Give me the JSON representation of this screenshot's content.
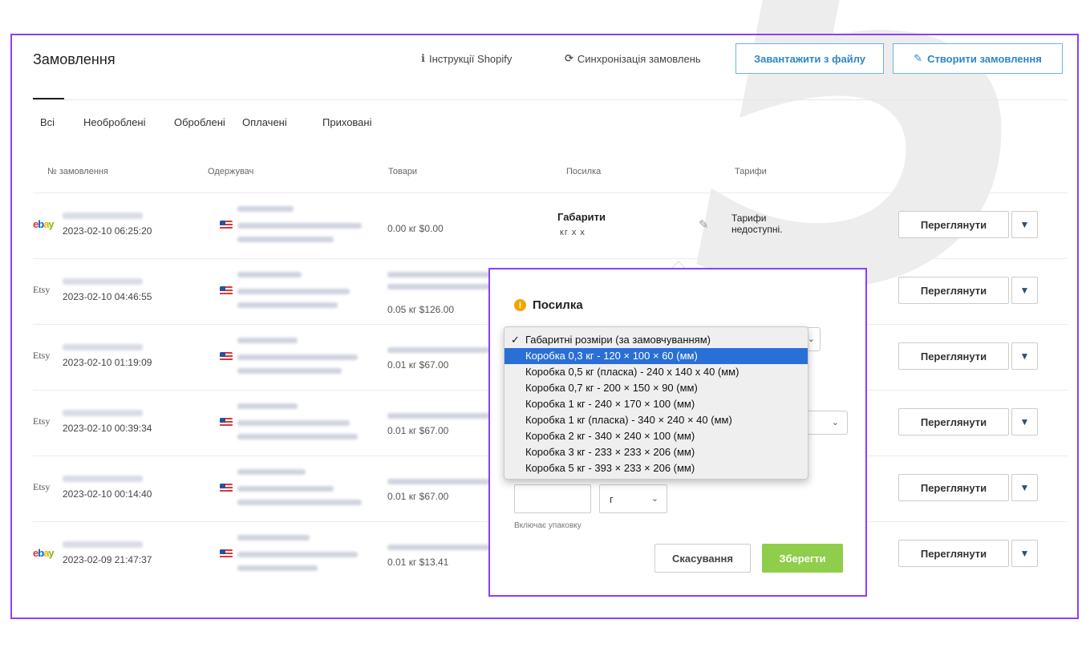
{
  "decor": {
    "digit": "5"
  },
  "header": {
    "title": "Замовлення",
    "shopify_label": "Інструкції Shopify",
    "sync_label": "Синхронізація замовлень",
    "upload_label": "Завантажити з файлу",
    "create_label": "Створити замовлення"
  },
  "tabs": [
    "Всі",
    "Необроблені",
    "Оброблені",
    "Оплачені",
    "Приховані"
  ],
  "columns": {
    "order": "№ замовлення",
    "recipient": "Одержувач",
    "goods": "Товари",
    "parcel": "Посилка",
    "tariffs": "Тарифи"
  },
  "rows": [
    {
      "store": "ebay",
      "date": "2023-02-10 06:25:20",
      "goods": "0.00 кг  $0.00",
      "view": "Переглянути",
      "parcel_title": "Габарити",
      "parcel_units": "кг х х",
      "tariff": "Тарифи недоступні."
    },
    {
      "store": "Etsy",
      "date": "2023-02-10 04:46:55",
      "goods": "0.05 кг  $126.00",
      "view": "Переглянути"
    },
    {
      "store": "Etsy",
      "date": "2023-02-10 01:19:09",
      "goods": "0.01 кг  $67.00",
      "view": "Переглянути"
    },
    {
      "store": "Etsy",
      "date": "2023-02-10 00:39:34",
      "goods": "0.01 кг  $67.00",
      "view": "Переглянути"
    },
    {
      "store": "Etsy",
      "date": "2023-02-10 00:14:40",
      "goods": "0.01 кг  $67.00",
      "view": "Переглянути"
    },
    {
      "store": "ebay",
      "date": "2023-02-09 21:47:37",
      "goods": "0.01 кг  $13.41",
      "view": "Переглянути"
    }
  ],
  "popover": {
    "title": "Посилка",
    "unit_value": "г",
    "pack_note": "Включає упаковку",
    "cancel_label": "Скасування",
    "save_label": "Зберегти"
  },
  "dropdown": {
    "selected_index": 0,
    "highlighted_index": 1,
    "options": [
      "Габаритні розміри (за замовчуванням)",
      "Коробка 0,3 кг - 120 × 100 × 60 (мм)",
      "Коробка 0,5 кг (пласка) - 240 х 140 х 40 (мм)",
      "Коробка 0,7 кг - 200 × 150 × 90 (мм)",
      "Коробка 1 кг - 240 × 170 × 100 (мм)",
      "Коробка 1 кг (пласка) - 340 × 240 × 40 (мм)",
      "Коробка 2 кг - 340 × 240 × 100 (мм)",
      "Коробка 3 кг - 233 × 233 × 206 (мм)",
      "Коробка 5 кг - 393 × 233 × 206 (мм)"
    ]
  },
  "colors": {
    "accent_frame": "#8a3ffc",
    "link_blue": "#2f86c4",
    "save_green": "#8fce4a",
    "highlight": "#2a6fd6"
  }
}
